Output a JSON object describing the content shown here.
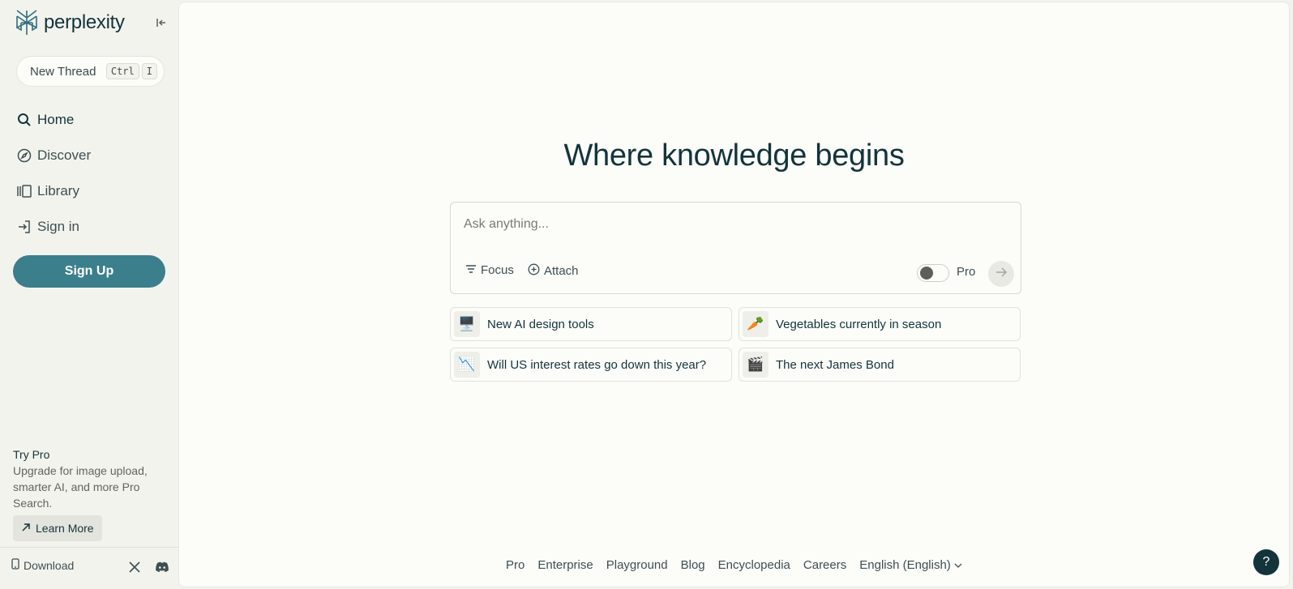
{
  "brand": {
    "name": "perplexity",
    "accent": "#3b7f8c",
    "dark": "#13343b"
  },
  "sidebar": {
    "new_thread": {
      "label": "New Thread",
      "kbd1": "Ctrl",
      "kbd2": "I"
    },
    "nav": [
      {
        "label": "Home",
        "icon": "search-icon"
      },
      {
        "label": "Discover",
        "icon": "compass-icon"
      },
      {
        "label": "Library",
        "icon": "library-icon"
      },
      {
        "label": "Sign in",
        "icon": "sign-in-icon"
      }
    ],
    "signup_label": "Sign Up",
    "try_pro": {
      "title": "Try Pro",
      "description": "Upgrade for image upload, smarter AI, and more Pro Search.",
      "learn_more": "Learn More"
    },
    "download_label": "Download"
  },
  "main": {
    "title": "Where knowledge begins",
    "search": {
      "placeholder": "Ask anything...",
      "focus_label": "Focus",
      "attach_label": "Attach",
      "pro_label": "Pro"
    },
    "suggestions": [
      {
        "emoji": "🖥️",
        "label": "New AI design tools"
      },
      {
        "emoji": "🥕",
        "label": "Vegetables currently in season"
      },
      {
        "emoji": "📉",
        "label": "Will US interest rates go down this year?"
      },
      {
        "emoji": "🎬",
        "label": "The next James Bond"
      }
    ],
    "footer": [
      "Pro",
      "Enterprise",
      "Playground",
      "Blog",
      "Encyclopedia",
      "Careers"
    ],
    "language": "English (English)",
    "help_label": "?"
  }
}
